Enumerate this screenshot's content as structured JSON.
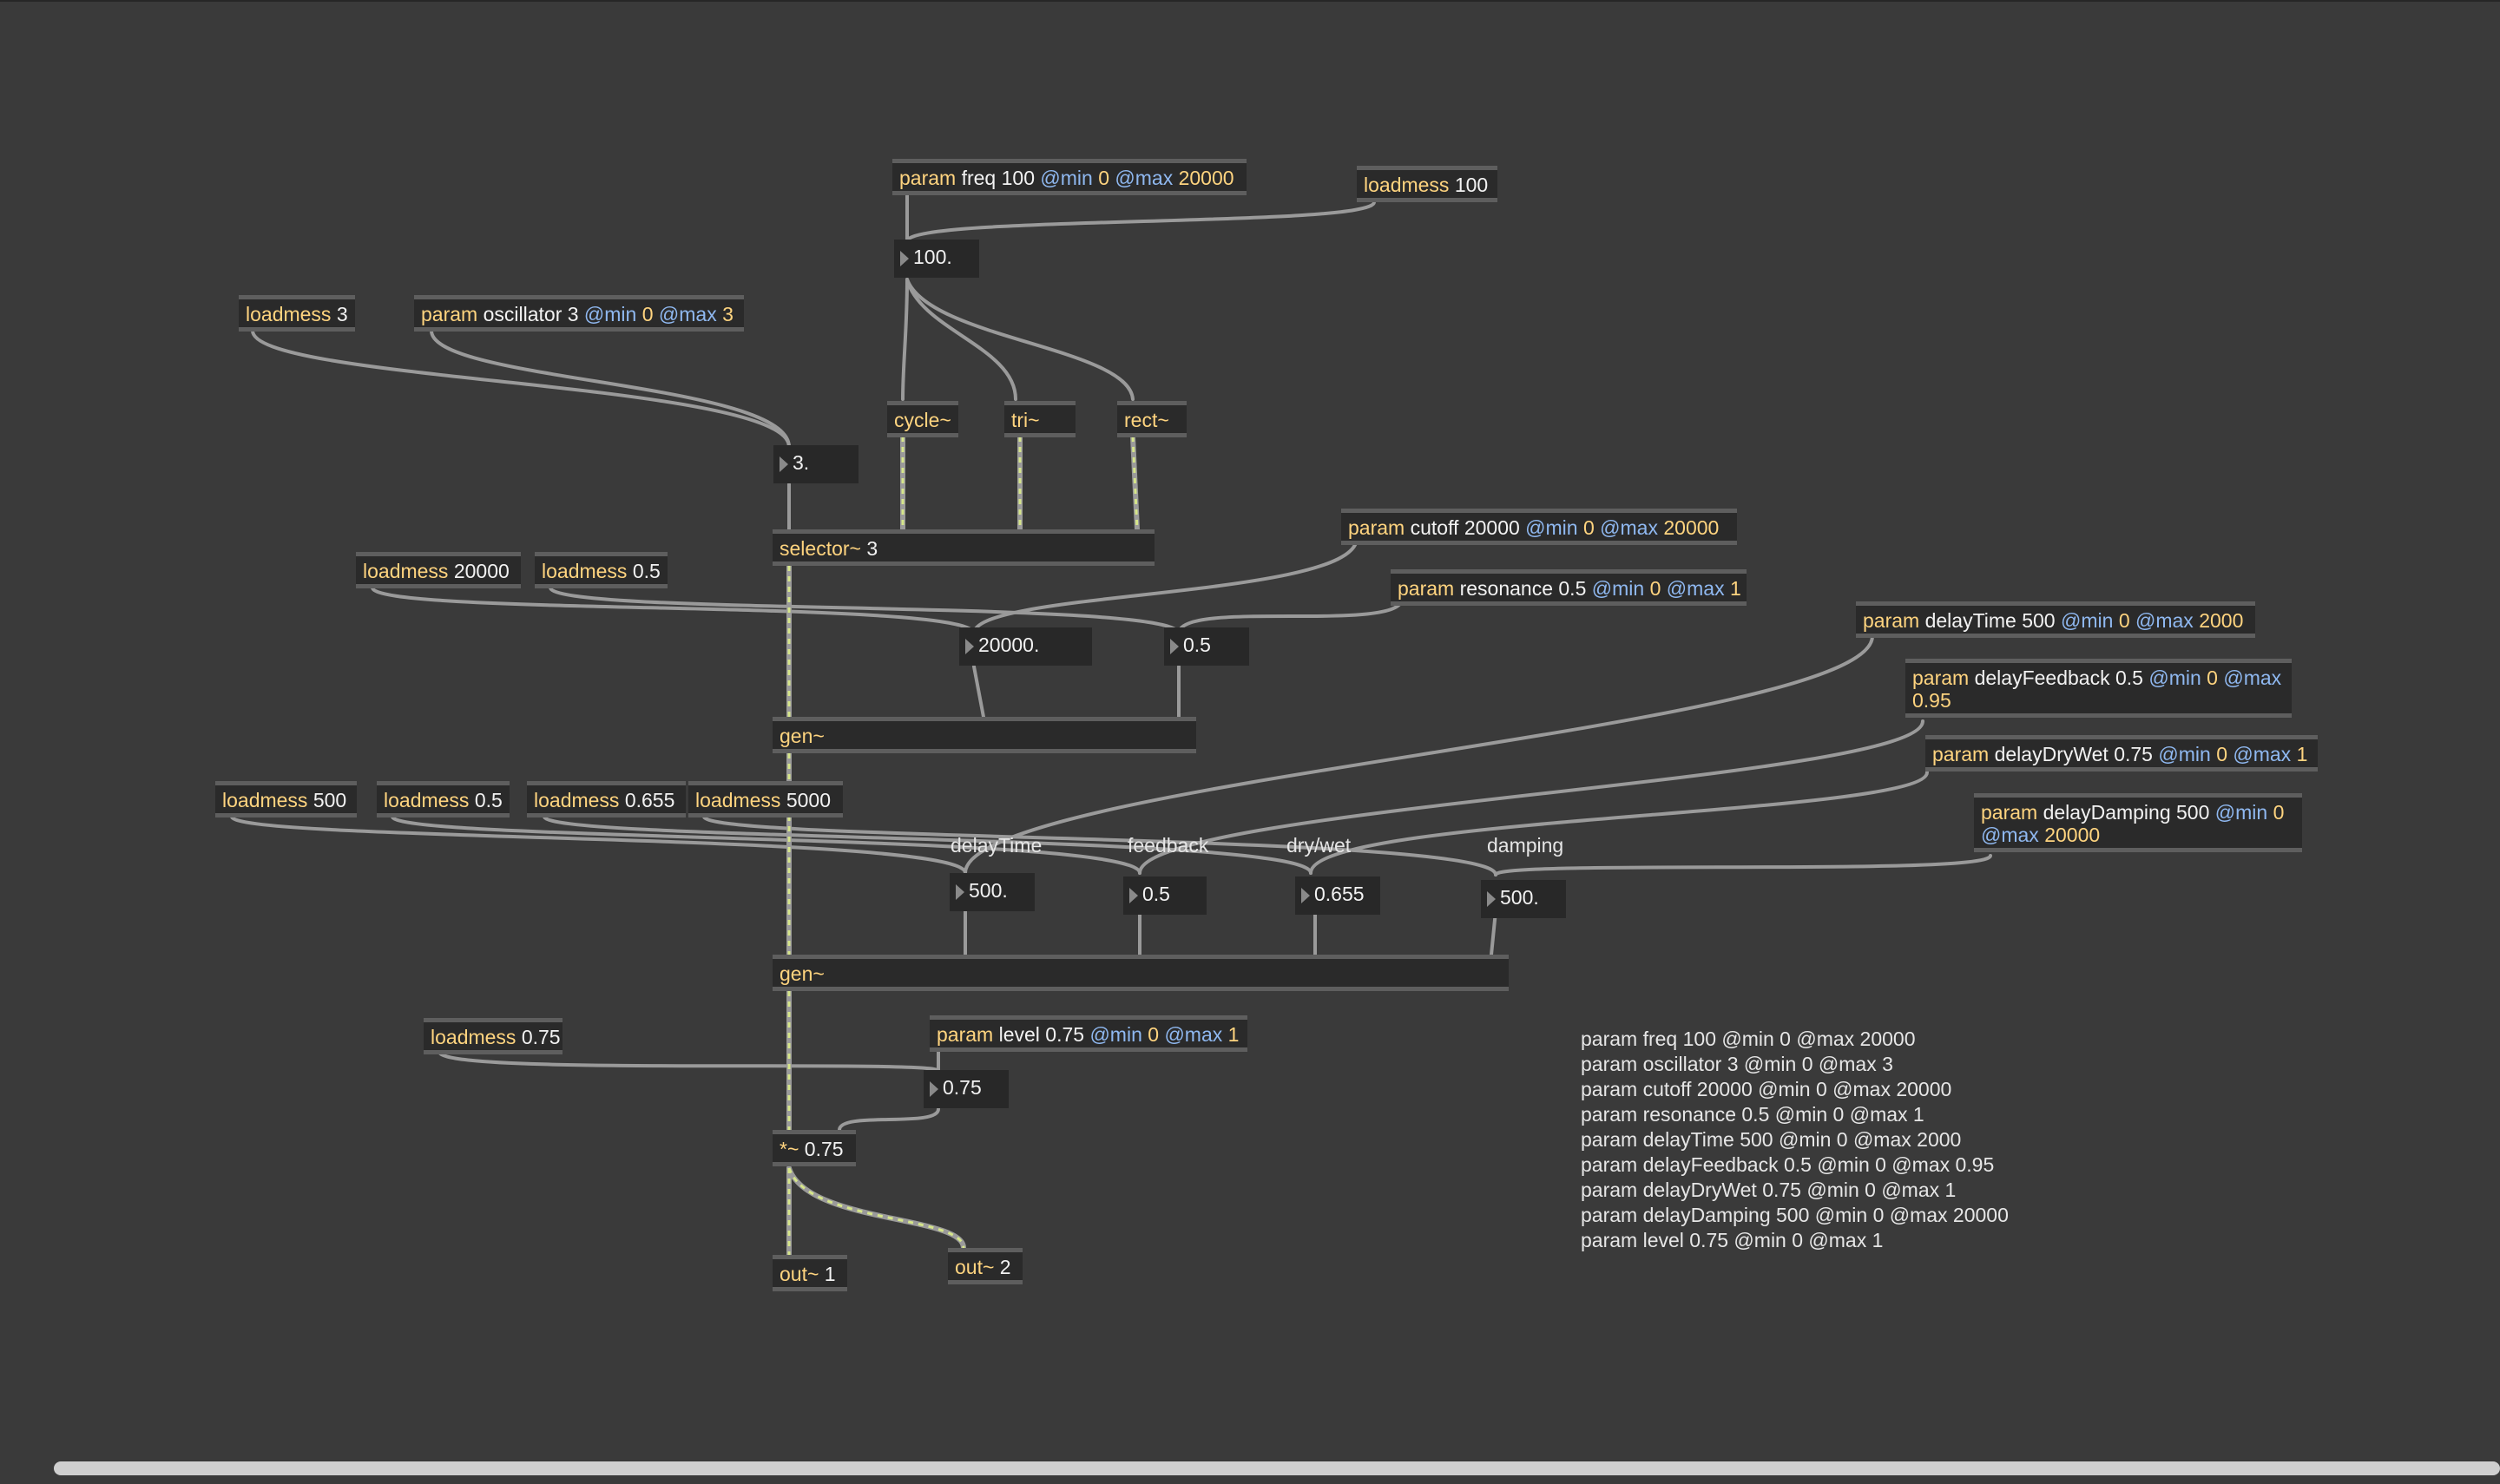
{
  "colors": {
    "background": "#3a3a3a",
    "object_fill": "#2a2a2a",
    "object_border": "#5e5e5e",
    "class_text": "#ffd47f",
    "attr_text": "#8fb8f0",
    "cord": "#9a9a9a",
    "signal_cord_dash": "#d6e68a"
  },
  "objects": {
    "param_freq": {
      "cls": "param",
      "arg": "freq 100",
      "a1": "@min",
      "v1": "0",
      "a2": "@max",
      "v2": "20000"
    },
    "loadmess_100": {
      "cls": "loadmess",
      "arg": "100"
    },
    "loadmess_3": {
      "cls": "loadmess",
      "arg": "3"
    },
    "param_oscillator": {
      "cls": "param",
      "arg": "oscillator 3",
      "a1": "@min",
      "v1": "0",
      "a2": "@max",
      "v2": "3"
    },
    "cycle": {
      "cls": "cycle~"
    },
    "tri": {
      "cls": "tri~"
    },
    "rect": {
      "cls": "rect~"
    },
    "selector": {
      "cls": "selector~",
      "arg": "3"
    },
    "param_cutoff": {
      "cls": "param",
      "arg": "cutoff 20000",
      "a1": "@min",
      "v1": "0",
      "a2": "@max",
      "v2": "20000"
    },
    "param_resonance": {
      "cls": "param",
      "arg": "resonance 0.5",
      "a1": "@min",
      "v1": "0",
      "a2": "@max",
      "v2": "1"
    },
    "loadmess_20000": {
      "cls": "loadmess",
      "arg": "20000"
    },
    "loadmess_05a": {
      "cls": "loadmess",
      "arg": "0.5"
    },
    "param_delaytime": {
      "cls": "param",
      "arg": "delayTime 500",
      "a1": "@min",
      "v1": "0",
      "a2": "@max",
      "v2": "2000"
    },
    "param_delayfeedback": {
      "cls": "param",
      "arg": "delayFeedback 0.5",
      "a1": "@min",
      "v1": "0",
      "a2": "@max",
      "v2": "0.95"
    },
    "param_delaydrywet": {
      "cls": "param",
      "arg": "delayDryWet 0.75",
      "a1": "@min",
      "v1": "0",
      "a2": "@max",
      "v2": "1"
    },
    "param_delaydamping": {
      "cls": "param",
      "arg": "delayDamping 500",
      "a1": "@min",
      "v1": "0",
      "a2": "@max",
      "v2": "20000"
    },
    "gen1": {
      "cls": "gen~"
    },
    "loadmess_500": {
      "cls": "loadmess",
      "arg": "500"
    },
    "loadmess_05b": {
      "cls": "loadmess",
      "arg": "0.5"
    },
    "loadmess_0655": {
      "cls": "loadmess",
      "arg": "0.655"
    },
    "loadmess_5000": {
      "cls": "loadmess",
      "arg": "5000"
    },
    "gen2": {
      "cls": "gen~"
    },
    "loadmess_075": {
      "cls": "loadmess",
      "arg": "0.75"
    },
    "param_level": {
      "cls": "param",
      "arg": "level 0.75",
      "a1": "@min",
      "v1": "0",
      "a2": "@max",
      "v2": "1"
    },
    "mult": {
      "cls": "*~",
      "arg": "0.75"
    },
    "out1": {
      "cls": "out~",
      "arg": "1"
    },
    "out2": {
      "cls": "out~",
      "arg": "2"
    }
  },
  "numbers": {
    "freq": "100.",
    "osc": "3.",
    "cutoff": "20000.",
    "resonance": "0.5",
    "delaytime": "500.",
    "feedback": "0.5",
    "drywet": "0.655",
    "damping": "500.",
    "level": "0.75"
  },
  "labels": {
    "delaytime": "delayTime",
    "feedback": "feedback",
    "drywet": "dry/wet",
    "damping": "damping"
  },
  "comment_lines": [
    "param freq 100 @min 0 @max 20000",
    "param oscillator 3 @min 0 @max 3",
    "param cutoff 20000 @min 0 @max 20000",
    "param resonance 0.5 @min 0 @max 1",
    "param delayTime 500 @min 0 @max 2000",
    "param delayFeedback 0.5 @min 0 @max 0.95",
    "param delayDryWet 0.75 @min 0 @max 1",
    "param delayDamping 500 @min 0 @max 20000",
    "param level 0.75 @min 0 @max 1"
  ]
}
